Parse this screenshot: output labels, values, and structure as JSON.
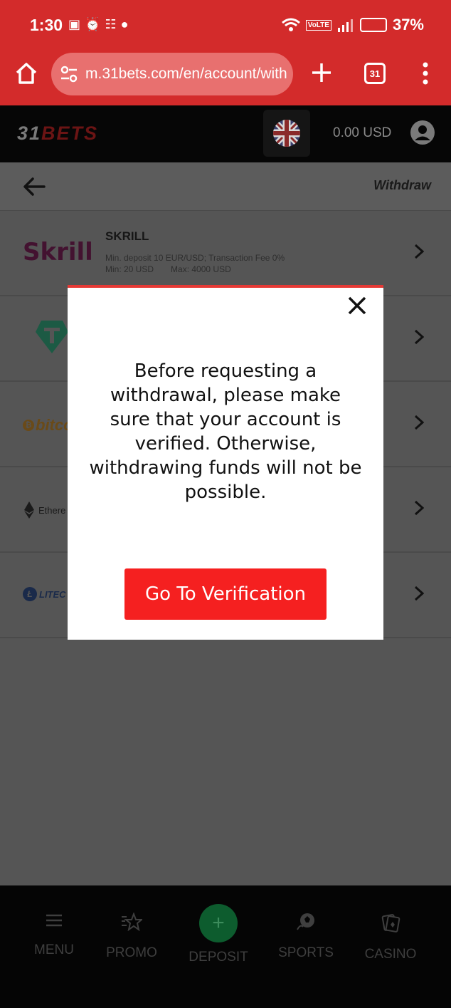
{
  "status_bar": {
    "time": "1:30",
    "network_badge": "VoLTE",
    "battery": "37%"
  },
  "browser": {
    "url": "m.31bets.com/en/account/with",
    "tab_count": "31"
  },
  "site_header": {
    "logo_number": "31",
    "logo_word": "BETS",
    "balance": "0.00 USD"
  },
  "page_header": {
    "title": "Withdraw"
  },
  "payment_methods": [
    {
      "logo": "Skrill",
      "name": "SKRILL",
      "info_line1": "Min. deposit 10 EUR/USD; Transaction Fee  0%",
      "info_min": "Min: 20 USD",
      "info_max": "Max: 4000 USD"
    },
    {
      "logo": "tether-logo"
    },
    {
      "logo": "bitco"
    },
    {
      "logo": "Ethere"
    },
    {
      "logo": "LITEC"
    }
  ],
  "modal": {
    "message": "Before requesting a withdrawal, please make sure that your account is verified. Otherwise, withdrawing funds will not be possible.",
    "button_label": "Go To Verification"
  },
  "bottom_nav": {
    "items": [
      {
        "label": "MENU",
        "icon": "menu-icon"
      },
      {
        "label": "PROMO",
        "icon": "promo-star-icon"
      },
      {
        "label": "DEPOSIT",
        "icon": "plus-circle-icon"
      },
      {
        "label": "SPORTS",
        "icon": "soccer-ball-icon"
      },
      {
        "label": "CASINO",
        "icon": "cards-icon"
      }
    ]
  },
  "colors": {
    "brand_red": "#d32b2b",
    "modal_button": "#f52020",
    "header_bg": "#060606"
  }
}
